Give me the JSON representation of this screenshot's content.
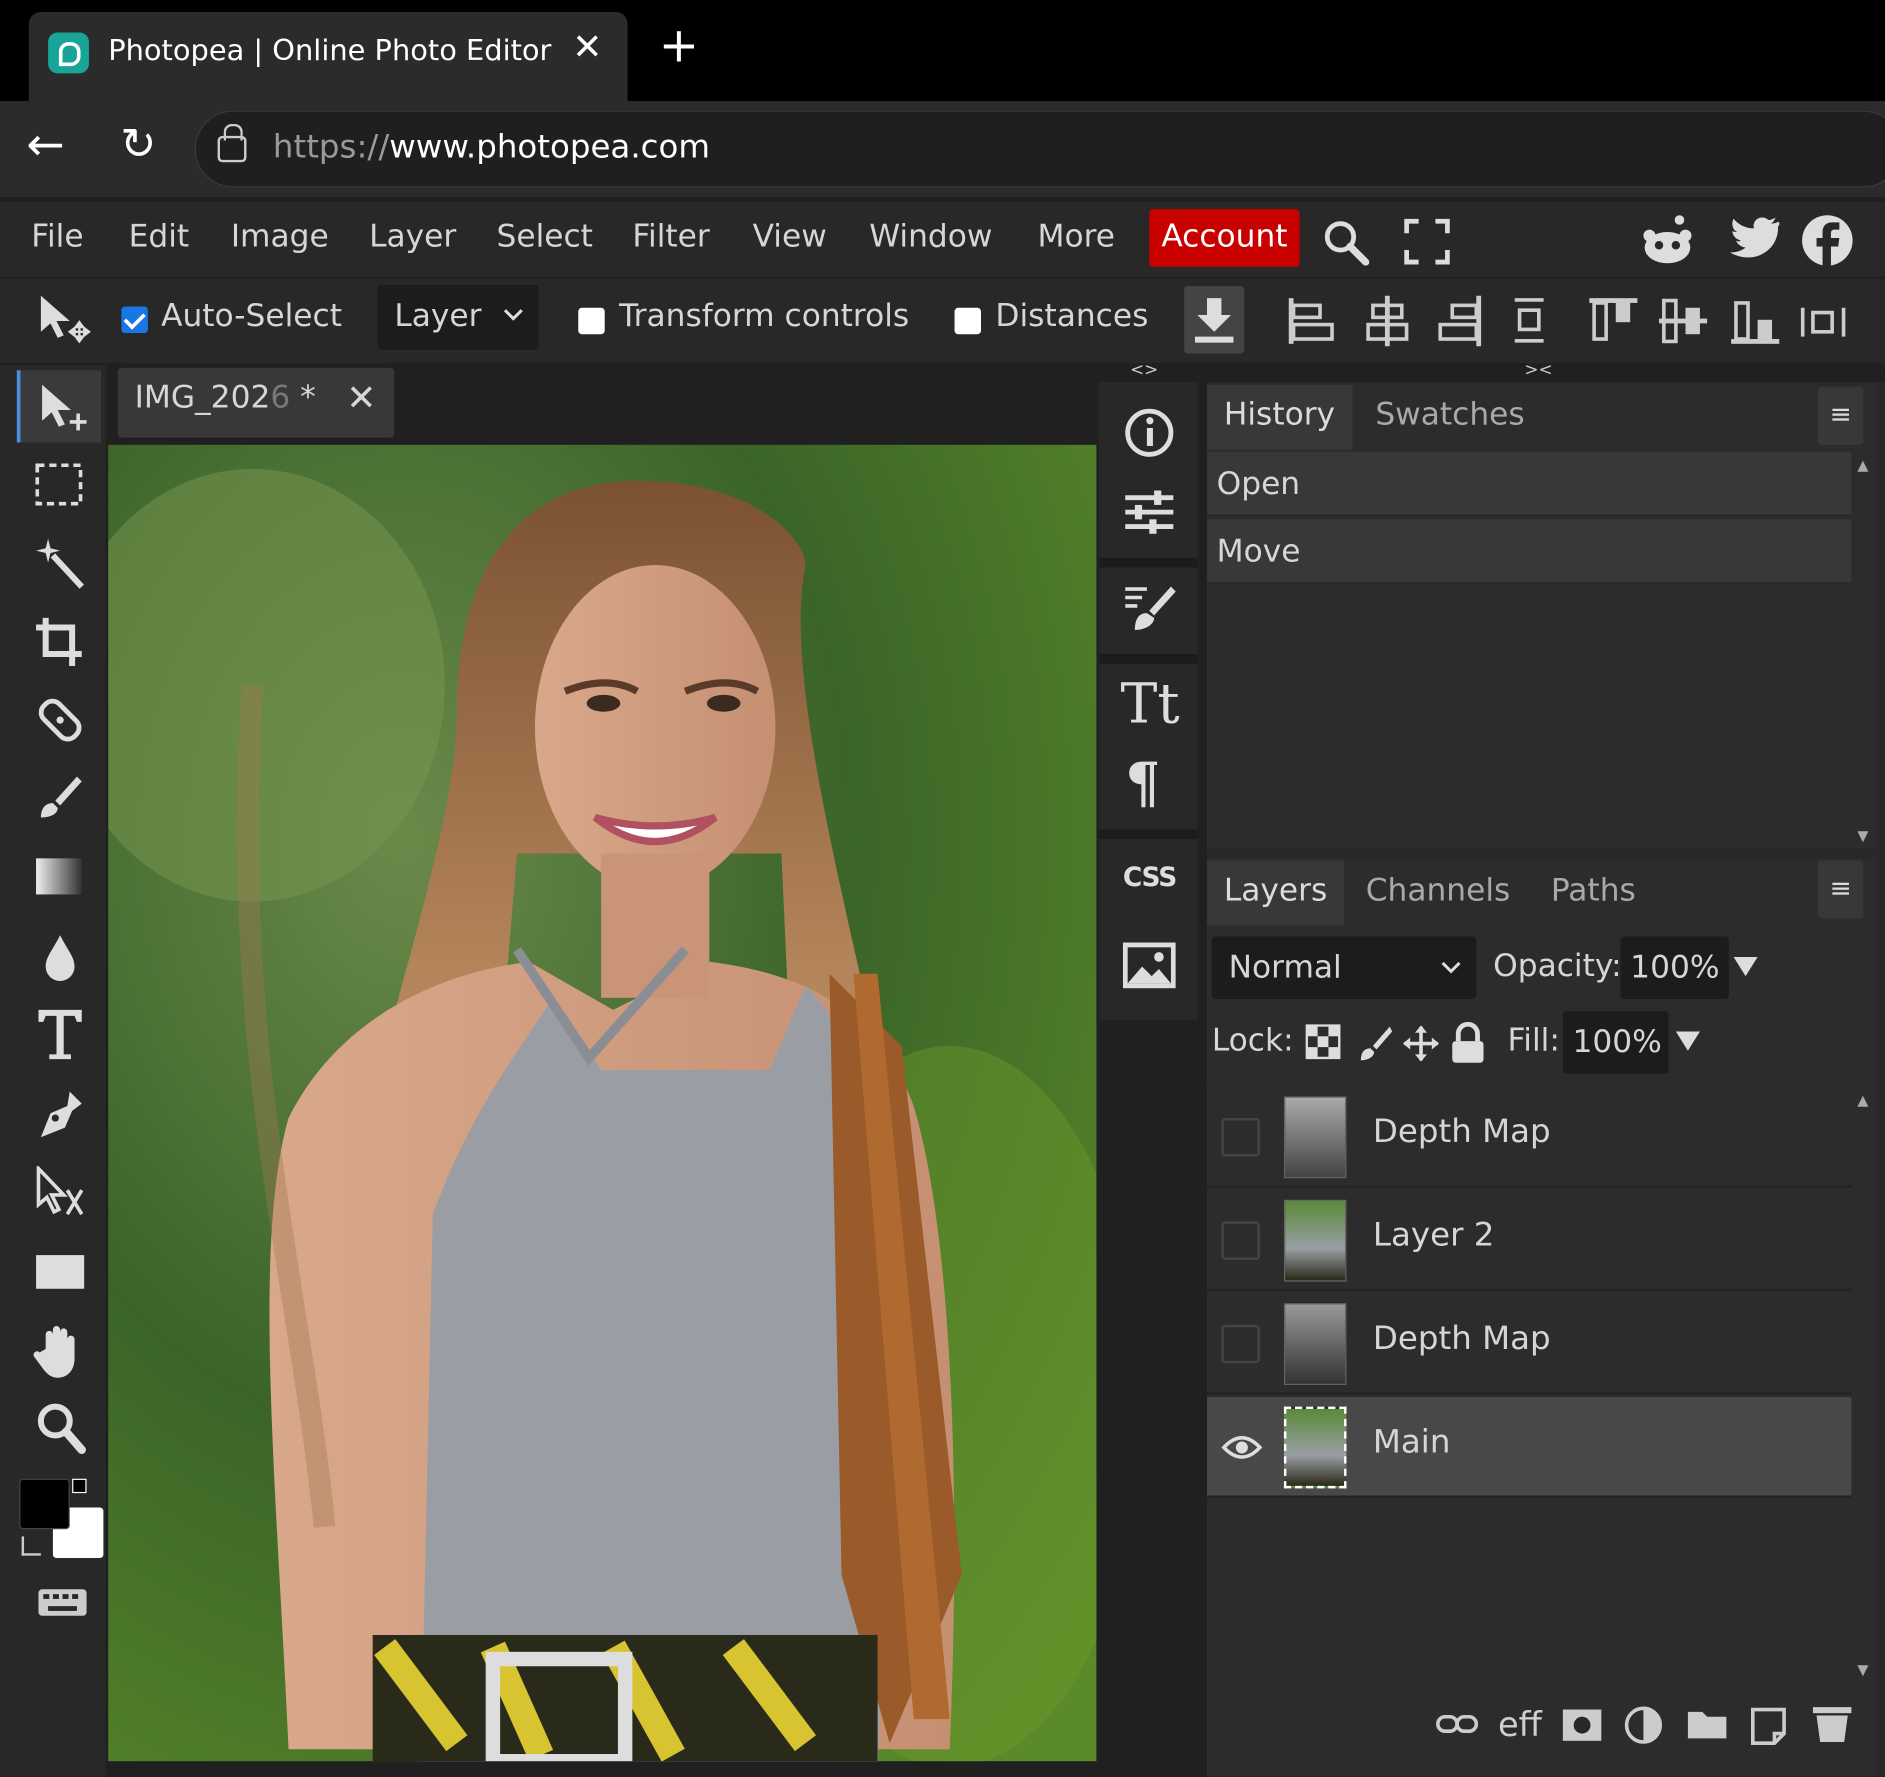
{
  "browser": {
    "tab_title": "Photopea | Online Photo Editor",
    "tab_close": "✕",
    "new_tab": "+",
    "url_scheme": "https://",
    "url_host": "www.photopea.com",
    "back": "←",
    "reload": "↻"
  },
  "menu": {
    "items": [
      "File",
      "Edit",
      "Image",
      "Layer",
      "Select",
      "Filter",
      "View",
      "Window",
      "More"
    ],
    "account": "Account"
  },
  "options": {
    "auto_select_label": "Auto-Select",
    "auto_select_checked": true,
    "layer_select_value": "Layer",
    "transform_controls_label": "Transform controls",
    "transform_checked": false,
    "distances_label": "Distances",
    "distances_checked": false
  },
  "document": {
    "tab_name_visible": "IMG_202",
    "tab_name_faded": "6",
    "tab_modified": " *",
    "tab_close": "✕"
  },
  "panel_toggles": {
    "left": "<>",
    "right": "><"
  },
  "icon_column": [
    "info-icon",
    "adjustments-icon",
    "brush-settings-icon",
    "character-icon",
    "paragraph-icon",
    "css-icon",
    "image-icon"
  ],
  "icon_labels": {
    "css": "CSS",
    "character": "Tt",
    "paragraph": "¶"
  },
  "history": {
    "tabs": [
      "History",
      "Swatches"
    ],
    "items": [
      "Open",
      "Move"
    ],
    "menu": "≡"
  },
  "layers": {
    "tabs": [
      "Layers",
      "Channels",
      "Paths"
    ],
    "menu": "≡",
    "blend_mode": "Normal",
    "opacity_label": "Opacity:",
    "opacity_value": "100%",
    "lock_label": "Lock:",
    "fill_label": "Fill:",
    "fill_value": "100%",
    "items": [
      {
        "name": "Depth Map",
        "visible": false
      },
      {
        "name": "Layer 2",
        "visible": false
      },
      {
        "name": "Depth Map",
        "visible": false
      },
      {
        "name": "Main",
        "visible": true
      }
    ]
  },
  "bottom_icons": [
    "link-icon",
    "effects-icon",
    "mask-icon",
    "adjustment-layer-icon",
    "folder-icon",
    "new-layer-icon",
    "trash-icon"
  ],
  "effects_label": "eff",
  "colors": {
    "account_bg": "#c80000",
    "accent_checkbox": "#1976e6",
    "foreground_color": "#000000",
    "background_color": "#ffffff"
  }
}
